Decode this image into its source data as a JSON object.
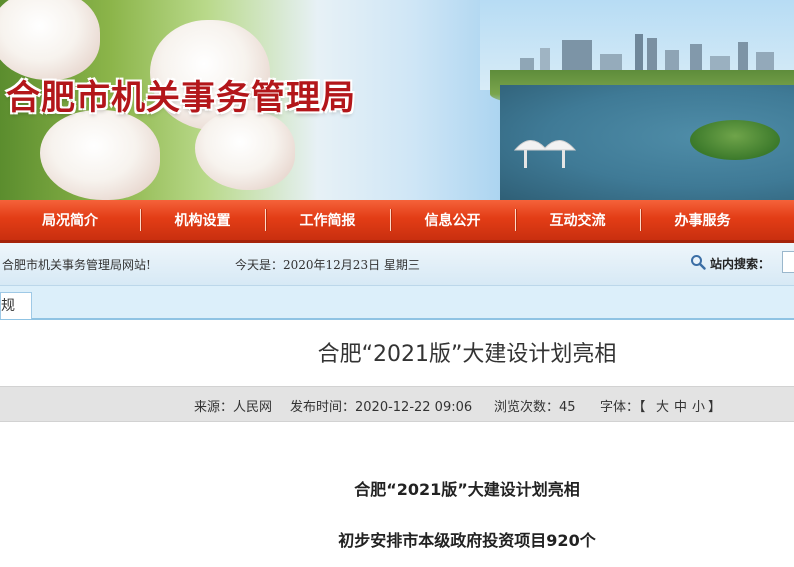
{
  "header": {
    "site_title": "合肥市机关事务管理局"
  },
  "nav": {
    "items": [
      {
        "label": "局况简介"
      },
      {
        "label": "机构设置"
      },
      {
        "label": "工作简报"
      },
      {
        "label": "信息公开"
      },
      {
        "label": "互动交流"
      },
      {
        "label": "办事服务"
      }
    ]
  },
  "info_bar": {
    "welcome": "合肥市机关事务管理局网站!",
    "date": "今天是：2020年12月23日  星期三",
    "search_label": "站内搜索："
  },
  "breadcrumb": {
    "tab_label": "规"
  },
  "article": {
    "title": "合肥“2021版”大建设计划亮相",
    "meta": {
      "source": "来源：人民网",
      "published": "发布时间：2020-12-22 09:06",
      "views": "浏览次数：45",
      "font_label": "字体：【",
      "font_large": "大",
      "font_medium": "中",
      "font_small": "小",
      "font_close": "】"
    },
    "body_heading": "合肥“2021版”大建设计划亮相",
    "body_subheading": "初步安排市本级政府投资项目920个"
  },
  "colors": {
    "nav_red": "#e33d16",
    "title_red": "#b3161a",
    "info_blue": "#d7e9f5"
  },
  "icons": {
    "search": "magnifier-icon"
  }
}
